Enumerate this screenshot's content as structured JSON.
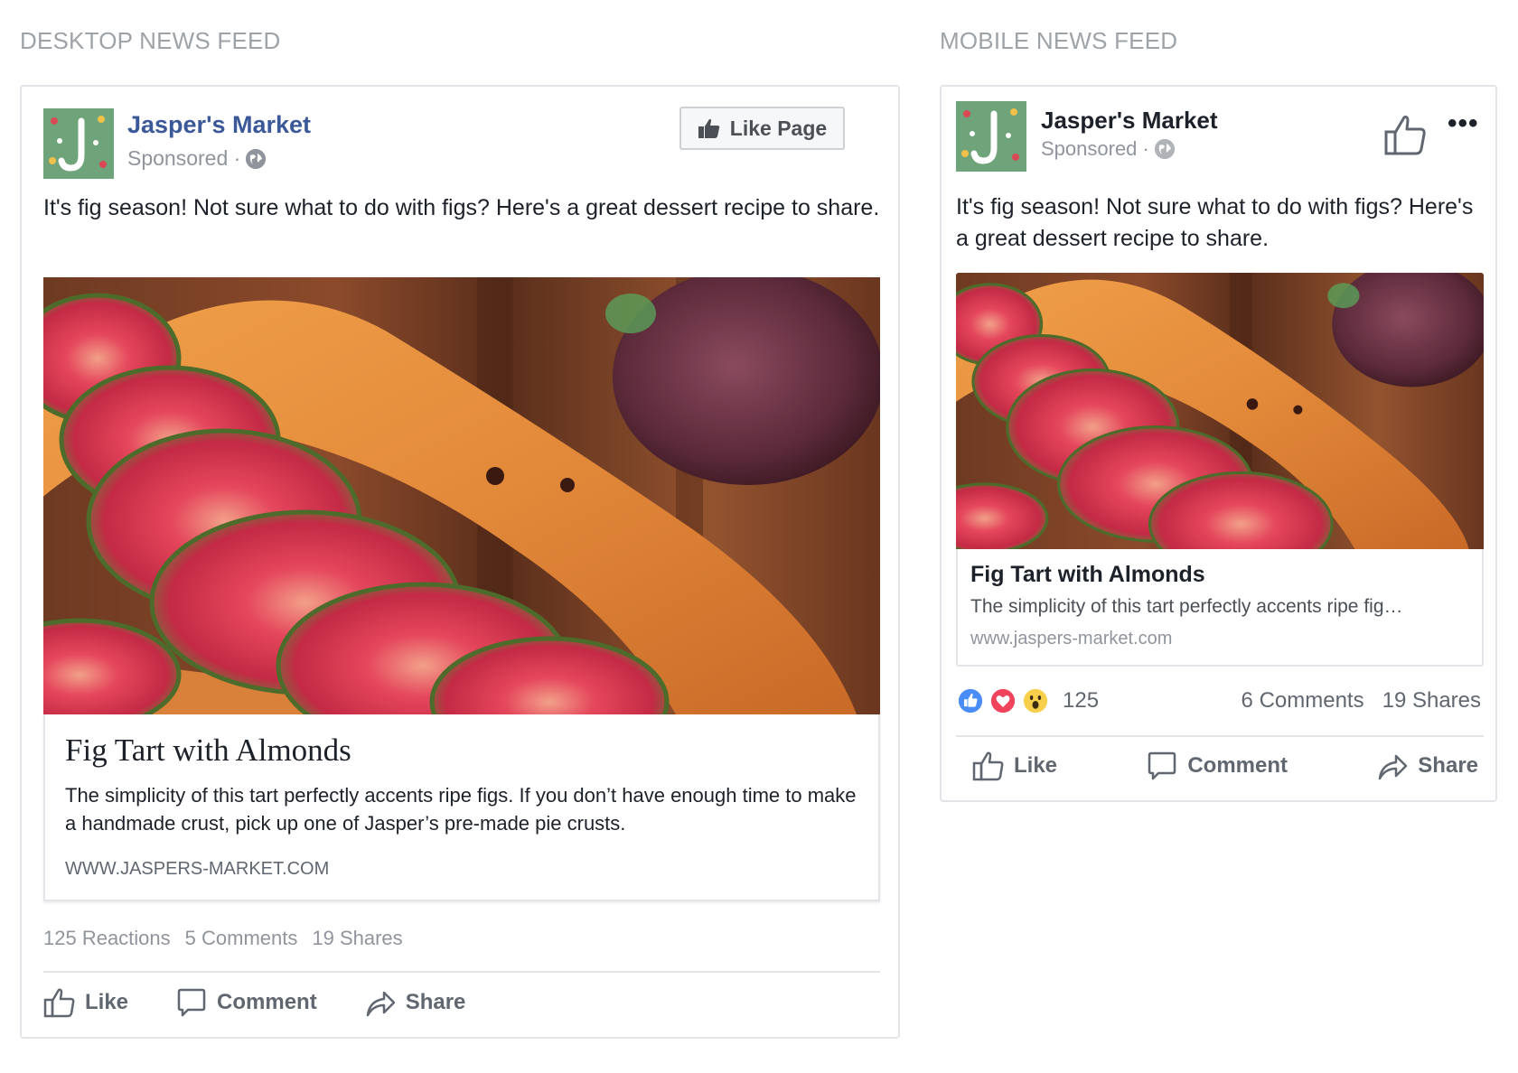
{
  "labels": {
    "desktop": "DESKTOP NEWS FEED",
    "mobile": "MOBILE NEWS FEED"
  },
  "desktop": {
    "page_name": "Jasper's Market",
    "sponsored": "Sponsored ·",
    "like_page_label": "Like Page",
    "post_text": "It's fig season! Not sure what to do with figs? Here's a great dessert recipe to share.",
    "link": {
      "title": "Fig Tart with Almonds",
      "description": "The simplicity of this tart perfectly accents ripe figs. If you don’t have enough time to make a handmade crust, pick up one of Jasper’s pre-made pie crusts.",
      "url": "WWW.JASPERS-MARKET.COM"
    },
    "stats": {
      "reactions": "125 Reactions",
      "comments": "5 Comments",
      "shares": "19 Shares"
    },
    "actions": {
      "like": "Like",
      "comment": "Comment",
      "share": "Share"
    }
  },
  "mobile": {
    "page_name": "Jasper's Market",
    "sponsored": "Sponsored ·",
    "more": "•••",
    "post_text": "It's fig season! Not sure what to do with figs? Here's a great dessert recipe to share.",
    "link": {
      "title": "Fig Tart with Almonds",
      "description": "The simplicity of this tart perfectly accents ripe fig…",
      "url": "www.jaspers-market.com"
    },
    "stats": {
      "reaction_count": "125",
      "comments": "6 Comments",
      "shares": "19 Shares"
    },
    "actions": {
      "like": "Like",
      "comment": "Comment",
      "share": "Share"
    }
  },
  "colors": {
    "brand_blue": "#3b5998",
    "like_blue": "#4a8df8",
    "love_red": "#f0445d",
    "wow_yellow": "#f8cf4a"
  }
}
